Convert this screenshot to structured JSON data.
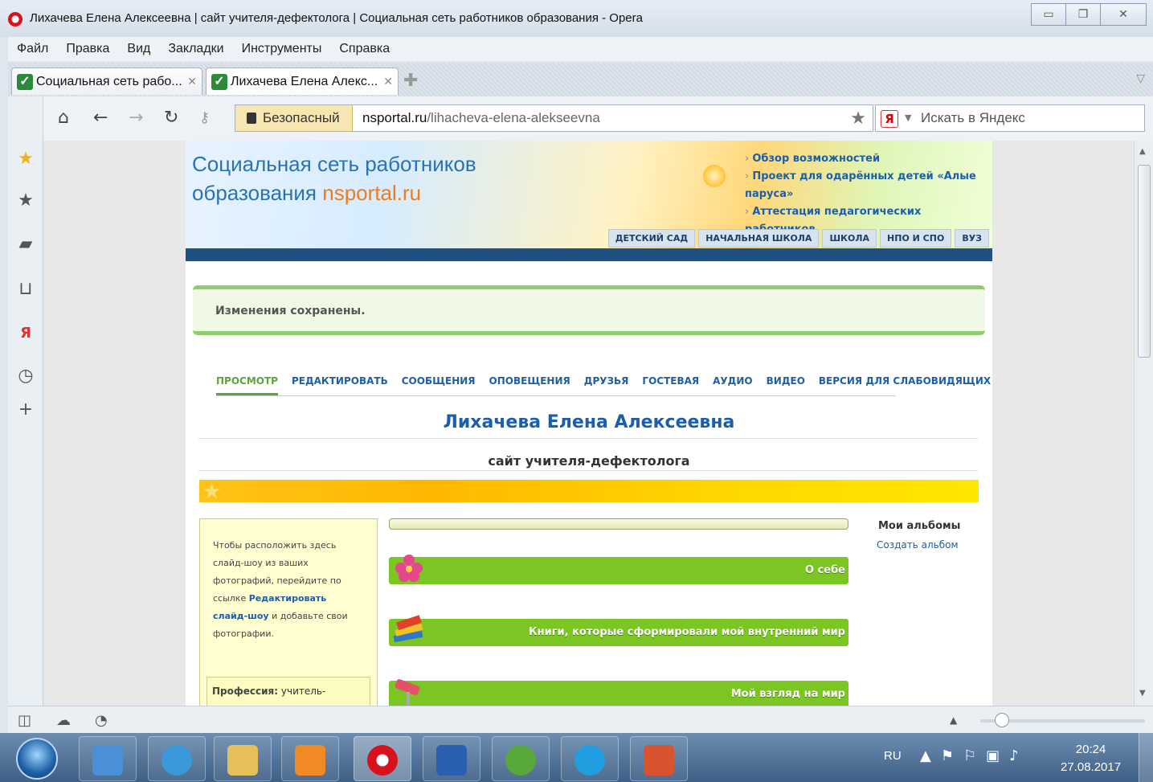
{
  "window": {
    "title": "Лихачева Елена Алексеевна | сайт учителя-дефектолога | Социальная сеть работников образования - Opera"
  },
  "menu": [
    "Файл",
    "Правка",
    "Вид",
    "Закладки",
    "Инструменты",
    "Справка"
  ],
  "tabs": [
    {
      "label": "Социальная сеть рабо...",
      "active": false
    },
    {
      "label": "Лихачева Елена Алекс...",
      "active": true
    }
  ],
  "address": {
    "security_label": "Безопасный",
    "domain": "nsportal.ru",
    "path": "/lihacheva-elena-alekseevna",
    "search_placeholder": "Искать в Яндекс"
  },
  "site": {
    "logo_line1": "Социальная сеть работников",
    "logo_line2_prefix": "образования ",
    "logo_line2_accent": "nsportal.ru",
    "header_links": [
      "Обзор возможностей",
      "Проект для одарённых детей «Алые паруса»",
      "Аттестация педагогических работников"
    ],
    "levels": [
      "ДЕТСКИЙ САД",
      "НАЧАЛЬНАЯ ШКОЛА",
      "ШКОЛА",
      "НПО И СПО",
      "ВУЗ"
    ],
    "notice": "Изменения сохранены.",
    "profile_tabs": [
      "ПРОСМОТР",
      "РЕДАКТИРОВАТЬ",
      "СООБЩЕНИЯ",
      "ОПОВЕЩЕНИЯ",
      "ДРУЗЬЯ",
      "ГОСТЕВАЯ",
      "АУДИО",
      "ВИДЕО",
      "ВЕРСИЯ ДЛЯ СЛАБОВИДЯЩИХ"
    ],
    "active_tab": "ПРОСМОТР",
    "person_name": "Лихачева Елена Алексеевна",
    "site_subtitle": "сайт учителя-дефектолога",
    "slideshow_text_1": "Чтобы расположить здесь слайд-шоу из ваших фотографий, перейдите по ссылке ",
    "slideshow_link": "Редактировать слайд-шоу",
    "slideshow_text_2": " и добавьте свои фотографии.",
    "profession_label": "Профессия:",
    "profession_value": " учитель-",
    "sections": [
      "О себе",
      "Книги, которые сформировали мой внутренний мир",
      "Мой взгляд на мир"
    ],
    "albums_title": "Мои альбомы",
    "albums_create": "Создать альбом"
  },
  "taskbar": {
    "lang": "RU",
    "time": "20:24",
    "date": "27.08.2017"
  }
}
